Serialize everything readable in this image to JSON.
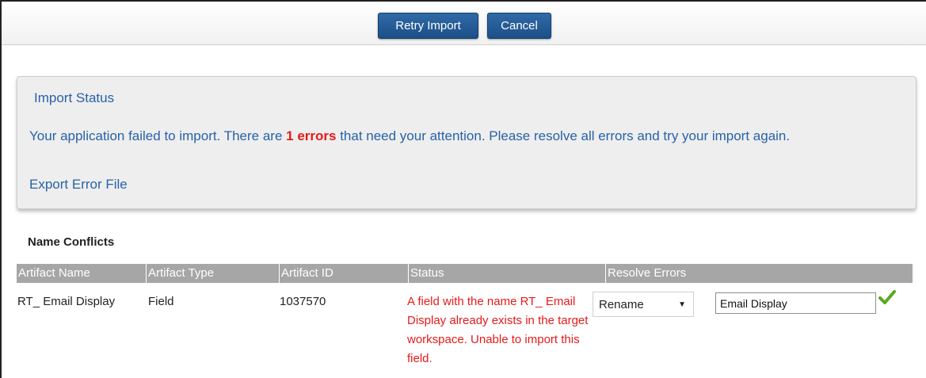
{
  "toolbar": {
    "retry_label": "Retry Import",
    "cancel_label": "Cancel"
  },
  "status_panel": {
    "title": "Import Status",
    "message_before": "Your application failed to import. There are ",
    "error_count": "1 errors",
    "message_after": " that need your attention. Please resolve all errors and try your import again.",
    "export_link": "Export Error File"
  },
  "conflicts": {
    "section_title": "Name Conflicts",
    "columns": [
      "Artifact Name",
      "Artifact Type",
      "Artifact ID",
      "Status",
      "Resolve Errors"
    ],
    "rows": [
      {
        "artifact_name": "RT_ Email Display",
        "artifact_type": "Field",
        "artifact_id": "1037570",
        "status": "A field with the name RT_ Email Display already exists in the target workspace. Unable to import this field.",
        "resolve_action": "Rename",
        "new_name": "Email Display"
      }
    ]
  },
  "icons": {
    "resolve_caret": "caret-down-icon",
    "confirm": "checkmark-icon"
  },
  "colors": {
    "button": "#1c4f86",
    "link_text": "#2862a8",
    "error": "#e51a1a",
    "header": "#a6a6a6",
    "check": "#5aa820"
  }
}
